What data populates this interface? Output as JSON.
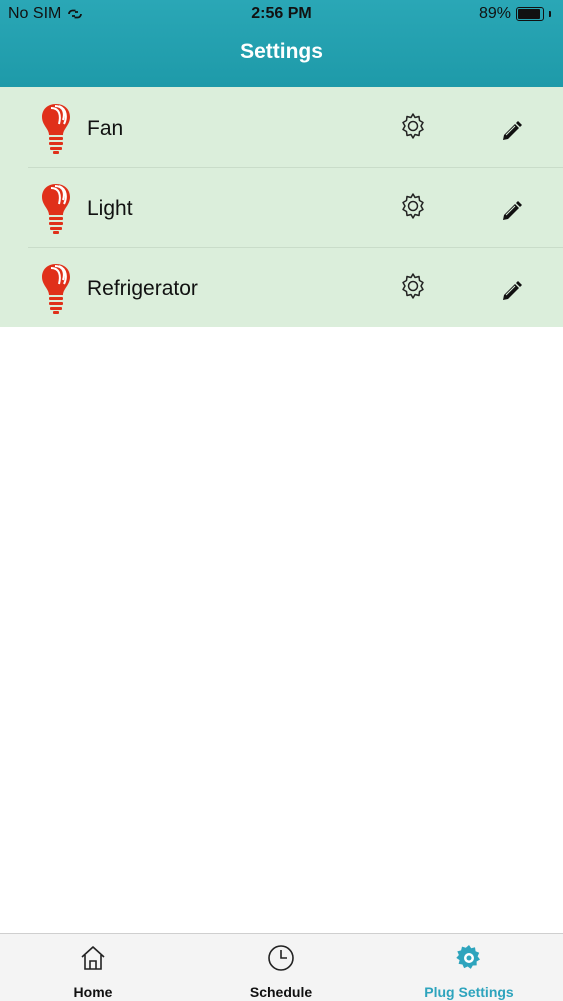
{
  "status_bar": {
    "carrier": "No SIM",
    "time": "2:56 PM",
    "battery": "89%"
  },
  "header": {
    "title": "Settings"
  },
  "plugs": [
    {
      "name": "Fan",
      "icon": "light-bulb-icon"
    },
    {
      "name": "Light",
      "icon": "light-bulb-icon"
    },
    {
      "name": "Refrigerator",
      "icon": "light-bulb-icon"
    }
  ],
  "tabbar": {
    "tabs": [
      {
        "label": "Home",
        "icon": "home-icon",
        "active": false
      },
      {
        "label": "Schedule",
        "icon": "clock-icon",
        "active": false
      },
      {
        "label": "Plug Settings",
        "icon": "gear-icon",
        "active": true
      }
    ]
  },
  "colors": {
    "header": "#1e9aa9",
    "list_background": "#dbeedb",
    "bulb": "#e0301a",
    "active_tab": "#2ea4bd"
  }
}
